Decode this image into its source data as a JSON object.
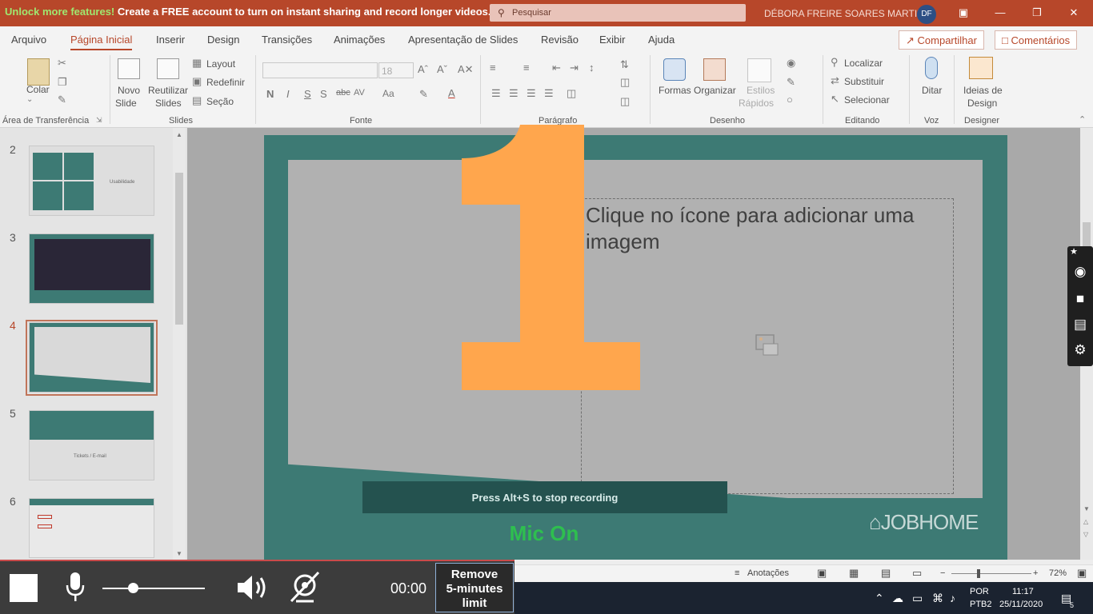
{
  "titlebar": {
    "banner_highlight": "Unlock more features!",
    "banner_text": " Create a FREE account to turn on instant sharing and record longer videos.",
    "search_placeholder": "Pesquisar",
    "user_name": "DÉBORA FREIRE SOARES MARTINS",
    "user_initials": "DF"
  },
  "tabs": [
    "Arquivo",
    "Página Inicial",
    "Inserir",
    "Design",
    "Transições",
    "Animações",
    "Apresentação de Slides",
    "Revisão",
    "Exibir",
    "Ajuda"
  ],
  "active_tab": "Página Inicial",
  "share": {
    "share_label": "Compartilhar",
    "comments_label": "Comentários"
  },
  "ribbon": {
    "clipboard": {
      "paste": "Colar",
      "group": "Área de Transferência"
    },
    "slides": {
      "new_slide_1": "Novo",
      "new_slide_2": "Slide",
      "reuse_1": "Reutilizar",
      "reuse_2": "Slides",
      "layout": "Layout",
      "reset": "Redefinir",
      "section": "Seção",
      "group": "Slides"
    },
    "font": {
      "size": "18",
      "group": "Fonte",
      "bold": "N",
      "italic": "I",
      "underline": "S",
      "shadow": "S",
      "strike": "abc",
      "spacing": "AV",
      "case": "Aa"
    },
    "paragraph": {
      "group": "Parágrafo"
    },
    "drawing": {
      "shapes": "Formas",
      "arrange": "Organizar",
      "quick_styles_1": "Estilos",
      "quick_styles_2": "Rápidos",
      "group": "Desenho"
    },
    "editing": {
      "find": "Localizar",
      "replace": "Substituir",
      "select": "Selecionar",
      "group": "Editando"
    },
    "voice": {
      "dictate": "Ditar",
      "group": "Voz"
    },
    "designer": {
      "ideas_1": "Ideias de",
      "ideas_2": "Design",
      "group": "Designer"
    }
  },
  "thumbnails": {
    "numbers": [
      "2",
      "3",
      "4",
      "5",
      "6"
    ],
    "slide2_text": "Usabilidade",
    "slide5_text": "Tickets / E-mail",
    "selected": "4"
  },
  "slide": {
    "placeholder_text": "Clique no ícone para adicionar uma imagem",
    "brand": "JOBHOME",
    "overlay_number": "1"
  },
  "recording": {
    "stop_hint": "Press Alt+S to stop recording",
    "mic_status": "Mic On",
    "timer": "00:00",
    "remove_line1": "Remove",
    "remove_line2": "5-minutes",
    "remove_line3": "limit",
    "volume_level": 0.3
  },
  "statusbar": {
    "notes": "Anotações",
    "zoom": "72%"
  },
  "taskbar": {
    "lang1": "POR",
    "lang2": "PTB2",
    "time": "11:17",
    "date": "25/11/2020",
    "notifications": "5"
  },
  "colors": {
    "accent": "#b7472a",
    "teal": "#3d7a74",
    "orange": "#ffa64d",
    "mic_green": "#2ebf4f"
  }
}
